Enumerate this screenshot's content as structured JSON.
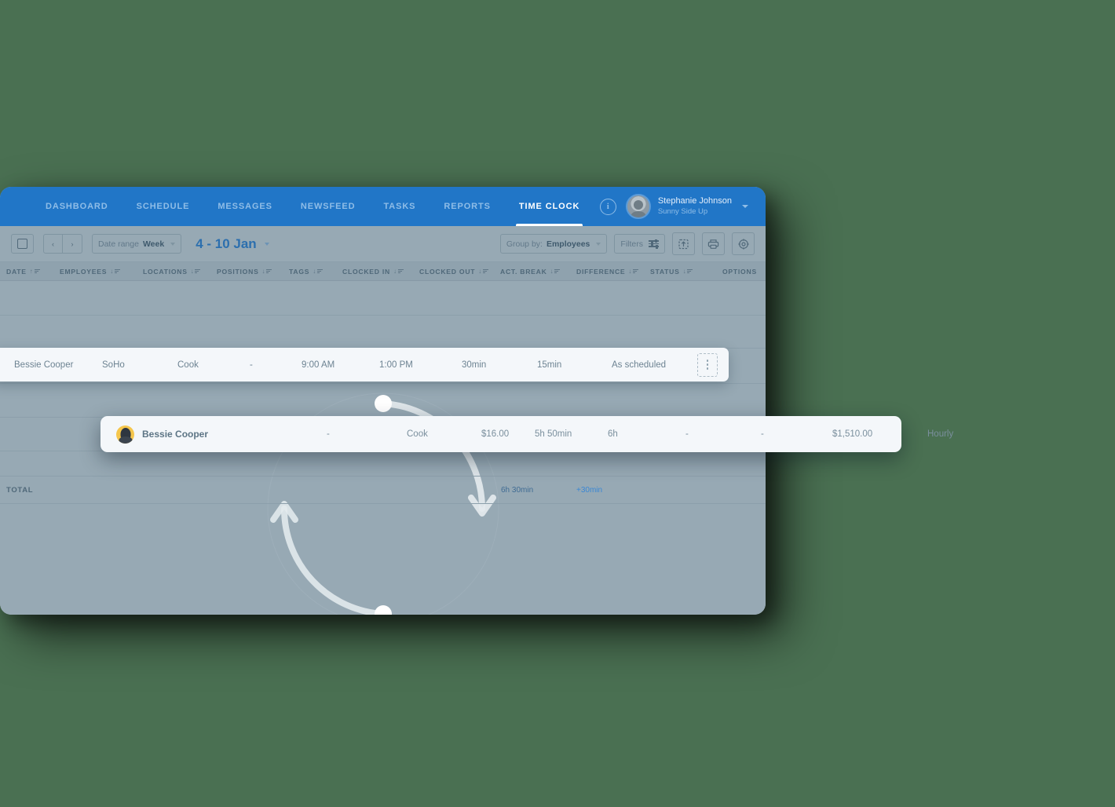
{
  "theme": {
    "page_background": "#4a7052",
    "nav_blue": "#2176c7",
    "panel_gray": "#97a9b4",
    "card_white": "#f4f7fa",
    "accent_blue": "#3a87d4",
    "avatar_gold": "#f5c64c"
  },
  "topnav": {
    "items": [
      {
        "label": "DASHBOARD",
        "active": false
      },
      {
        "label": "SCHEDULE",
        "active": false
      },
      {
        "label": "MESSAGES",
        "active": false
      },
      {
        "label": "NEWSFEED",
        "active": false
      },
      {
        "label": "TASKS",
        "active": false
      },
      {
        "label": "REPORTS",
        "active": false
      },
      {
        "label": "TIME CLOCK",
        "active": true
      }
    ],
    "info_icon": "info-icon",
    "user": {
      "name": "Stephanie Johnson",
      "organization": "Sunny Side Up",
      "avatar_icon": "user-avatar",
      "caret_icon": "chevron-down-icon"
    }
  },
  "toolbar": {
    "panel_toggle_icon": "square-panel-icon",
    "prev_label": "‹",
    "next_label": "›",
    "date_range_label": "Date range",
    "date_range_value": "Week",
    "date_title": "4 - 10 Jan",
    "group_by_label": "Group by:",
    "group_by_value": "Employees",
    "filters_label": "Filters",
    "filters_icon": "sliders-icon",
    "export_icon": "export-upload-icon",
    "print_icon": "printer-icon",
    "settings_icon": "gear-icon"
  },
  "table": {
    "columns": [
      {
        "label": "DATE",
        "sort": "asc"
      },
      {
        "label": "EMPLOYEES",
        "sort": "desc"
      },
      {
        "label": "LOCATIONS",
        "sort": "desc"
      },
      {
        "label": "POSITIONS",
        "sort": "desc"
      },
      {
        "label": "TAGS",
        "sort": "desc"
      },
      {
        "label": "CLOCKED IN",
        "sort": "desc"
      },
      {
        "label": "CLOCKED OUT",
        "sort": "desc"
      },
      {
        "label": "ACT. BREAK",
        "sort": "desc"
      },
      {
        "label": "DIFFERENCE",
        "sort": "desc"
      },
      {
        "label": "STATUS",
        "sort": "desc"
      },
      {
        "label": "OPTIONS",
        "sort": "none"
      }
    ],
    "highlight_row": {
      "employee": "Bessie Cooper",
      "location": "SoHo",
      "position": "Cook",
      "tags": "-",
      "clocked_in": "9:00 AM",
      "clocked_out": "1:00 PM",
      "act_break": "30min",
      "difference": "15min",
      "status": "As scheduled",
      "options_icon": "more-vertical-icon"
    },
    "total": {
      "label": "TOTAL",
      "hours": "6h 30min",
      "difference": "+30min"
    }
  },
  "summary_card": {
    "avatar_icon": "employee-avatar",
    "employee": "Bessie Cooper",
    "col2": "-",
    "position": "Cook",
    "rate": "$16.00",
    "worked": "5h 50min",
    "scheduled": "6h",
    "col7": "-",
    "col8": "-",
    "total_pay": "$1,510.00",
    "pay_type": "Hourly"
  },
  "sync_graphic": {
    "icon": "sync-cycle-icon",
    "description": "circular sync arrows"
  }
}
